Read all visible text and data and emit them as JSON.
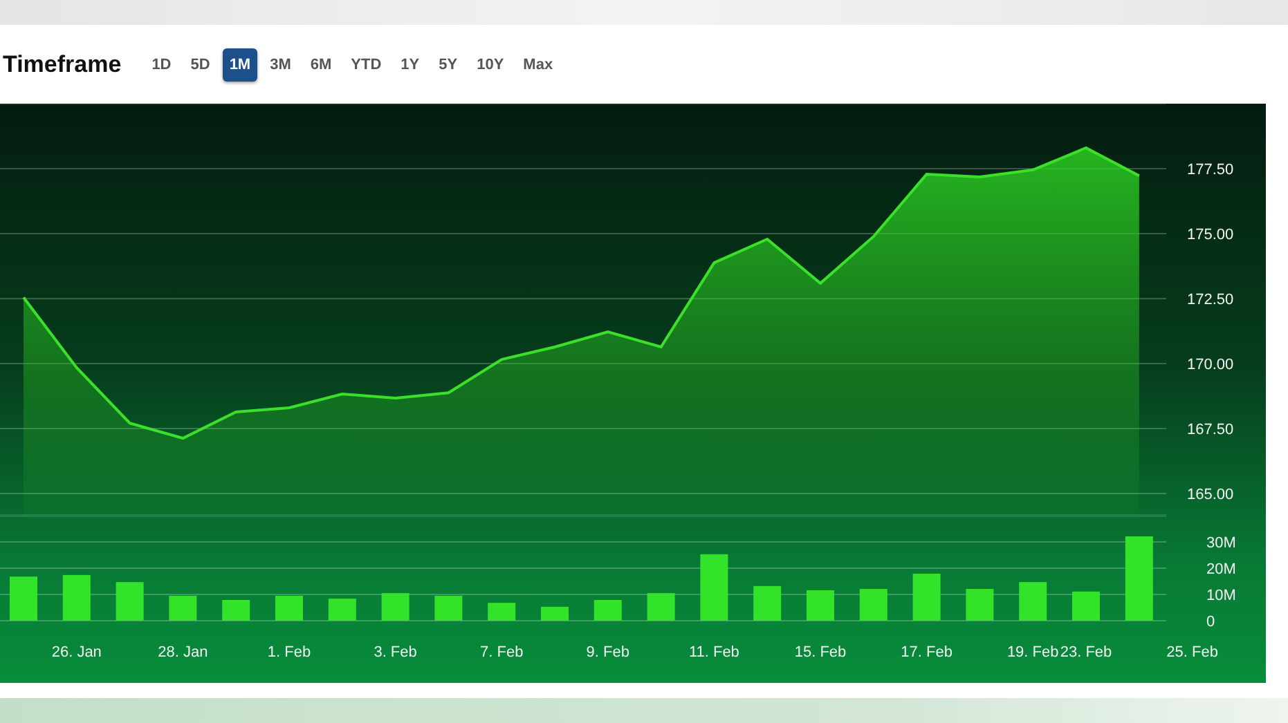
{
  "header": {
    "title": "Timeframe",
    "timeframes": [
      {
        "label": "1D",
        "selected": false
      },
      {
        "label": "5D",
        "selected": false
      },
      {
        "label": "1M",
        "selected": true
      },
      {
        "label": "3M",
        "selected": false
      },
      {
        "label": "6M",
        "selected": false
      },
      {
        "label": "YTD",
        "selected": false
      },
      {
        "label": "1Y",
        "selected": false
      },
      {
        "label": "5Y",
        "selected": false
      },
      {
        "label": "10Y",
        "selected": false
      },
      {
        "label": "Max",
        "selected": false
      }
    ]
  },
  "price_chart": {
    "chart_data": {
      "type": "area",
      "grid": true,
      "ylim": [
        164.15,
        180
      ],
      "series": [
        {
          "color": "#3be02a",
          "values": [
            172.55,
            169.84,
            167.71,
            167.13,
            168.14,
            168.3,
            168.83,
            168.67,
            168.88,
            170.16,
            170.64,
            171.22,
            170.64,
            173.88,
            174.79,
            173.09,
            174.89,
            177.29,
            177.18,
            177.45,
            178.3,
            177.23
          ]
        }
      ],
      "yticks": [
        {
          "value": 177.5,
          "label": "177.50"
        },
        {
          "value": 175,
          "label": "175.00"
        },
        {
          "value": 172.5,
          "label": "172.50"
        },
        {
          "value": 170,
          "label": "170.00"
        },
        {
          "value": 167.5,
          "label": "167.50"
        },
        {
          "value": 165,
          "label": "165.00"
        }
      ]
    }
  },
  "volume_chart": {
    "chart_data": {
      "type": "bar",
      "grid": true,
      "ylim": [
        0,
        40
      ],
      "categories": [
        null,
        "26. Jan",
        null,
        "28. Jan",
        null,
        "1. Feb",
        null,
        "3. Feb",
        null,
        "7. Feb",
        null,
        "9. Feb",
        null,
        "11. Feb",
        null,
        "15. Feb",
        null,
        "17. Feb",
        null,
        "19. Feb",
        "23. Feb",
        null,
        "25. Feb"
      ],
      "series": [
        {
          "color": "#33e32a",
          "values": [
            16.8,
            17.4,
            14.7,
            9.5,
            7.9,
            9.5,
            8.4,
            10.5,
            9.5,
            6.8,
            5.3,
            7.9,
            10.5,
            25.3,
            13.2,
            11.6,
            12.1,
            17.9,
            12.1,
            14.7,
            11.1,
            32.1,
            null
          ]
        }
      ],
      "yticks": [
        {
          "value": 30,
          "label": "30M"
        },
        {
          "value": 20,
          "label": "20M"
        },
        {
          "value": 10,
          "label": "10M"
        },
        {
          "value": 0,
          "label": "0"
        }
      ]
    }
  }
}
